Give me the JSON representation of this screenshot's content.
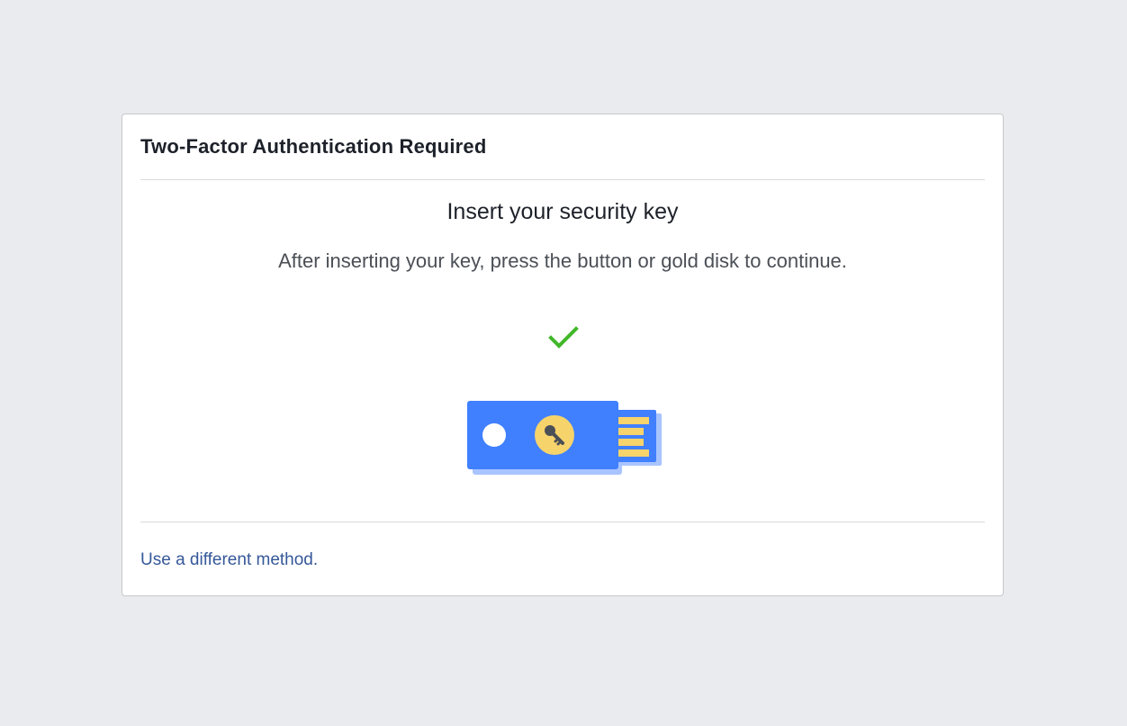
{
  "dialog": {
    "title": "Two-Factor Authentication Required",
    "heading": "Insert your security key",
    "instructions": "After inserting your key, press the button or gold disk to continue.",
    "status_icon": "checkmark-icon",
    "illustration_icon": "security-key-icon",
    "alternate_method_link": "Use a different method."
  },
  "colors": {
    "background": "#e9ebee",
    "link": "#365899",
    "check": "#42b72a",
    "key_body": "#4080ff",
    "key_gold": "#f7d36b"
  }
}
